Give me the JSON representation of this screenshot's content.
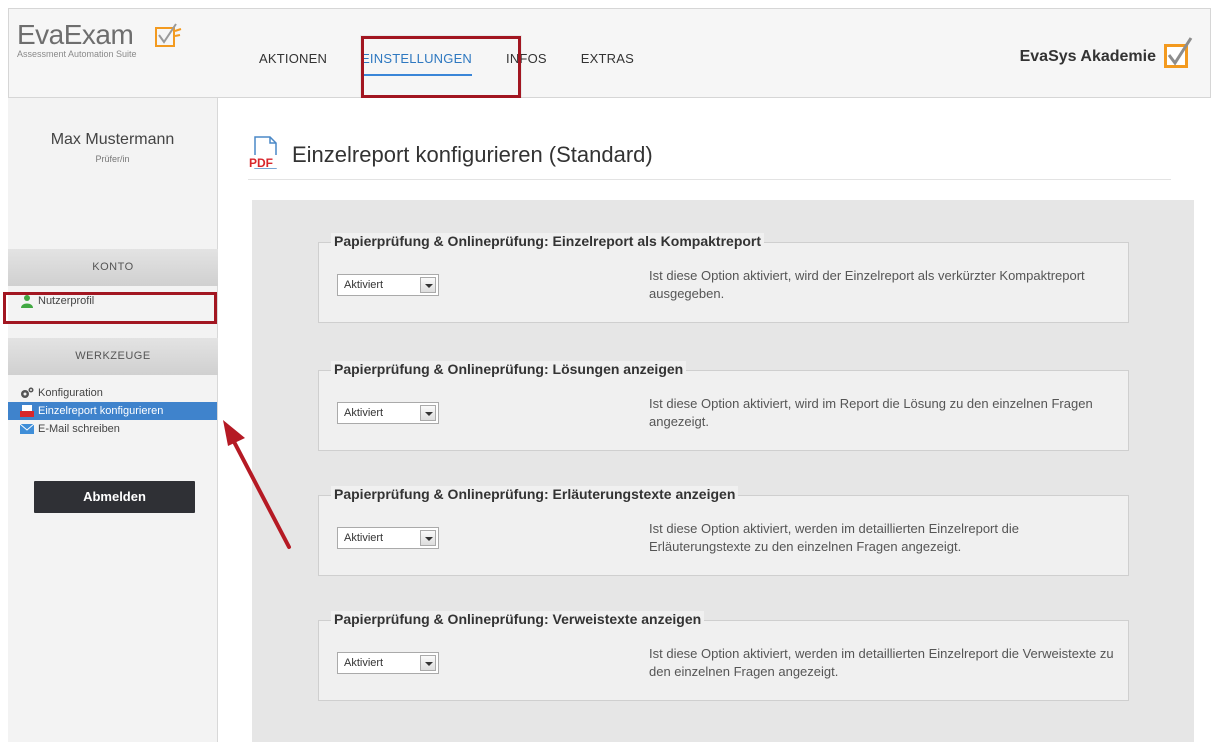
{
  "header": {
    "logo_text": "EvaExam",
    "logo_subtitle": "Assessment Automation Suite",
    "brand_name": "EvaSys Akademie",
    "nav": [
      {
        "label": "AKTIONEN"
      },
      {
        "label": "EINSTELLUNGEN",
        "active": true
      },
      {
        "label": "INFOS"
      },
      {
        "label": "EXTRAS"
      }
    ]
  },
  "sidebar": {
    "user_name": "Max Mustermann",
    "user_role": "Prüfer/in",
    "sections": [
      {
        "title": "KONTO",
        "items": [
          {
            "label": "Nutzerprofil",
            "icon": "user-icon"
          }
        ]
      },
      {
        "title": "WERKZEUGE",
        "items": [
          {
            "label": "Konfiguration",
            "icon": "gear-icon"
          },
          {
            "label": "Einzelreport konfigurieren",
            "icon": "pdf-icon",
            "active": true
          },
          {
            "label": "E-Mail schreiben",
            "icon": "mail-icon"
          }
        ]
      }
    ],
    "logout_label": "Abmelden"
  },
  "main": {
    "page_title": "Einzelreport konfigurieren (Standard)",
    "options": [
      {
        "title": "Papierprüfung & Onlineprüfung: Einzelreport als Kompaktreport",
        "value": "Aktiviert",
        "description": "Ist diese Option aktiviert, wird der Einzelreport als verkürzter Kompaktreport ausgegeben."
      },
      {
        "title": "Papierprüfung & Onlineprüfung: Lösungen anzeigen",
        "value": "Aktiviert",
        "description": "Ist diese Option aktiviert, wird im Report die Lösung zu den einzelnen Fragen angezeigt."
      },
      {
        "title": "Papierprüfung & Onlineprüfung: Erläuterungstexte anzeigen",
        "value": "Aktiviert",
        "description": "Ist diese Option aktiviert, werden im detaillierten Einzelreport die Erläuterungstexte zu den einzelnen Fragen angezeigt."
      },
      {
        "title": "Papierprüfung & Onlineprüfung: Verweistexte anzeigen",
        "value": "Aktiviert",
        "description": "Ist diese Option aktiviert, werden im detaillierten Einzelreport die Verweistexte zu den einzelnen Fragen angezeigt."
      }
    ]
  },
  "colors": {
    "accent_blue": "#3f83cc",
    "highlight_red": "#a21621",
    "logo_orange": "#f39a1f"
  }
}
